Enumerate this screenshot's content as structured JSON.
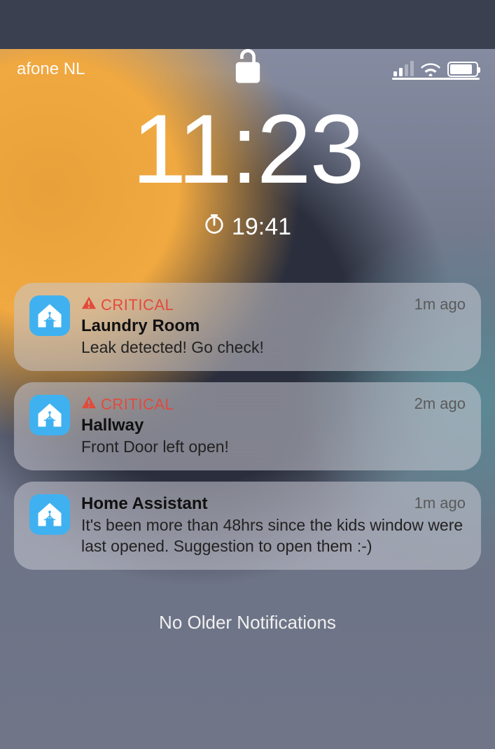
{
  "status_bar": {
    "carrier": "afone NL",
    "signal_active_bars": 2
  },
  "lock_screen": {
    "time": "11:23",
    "timer": "19:41"
  },
  "badge_label": "CRITICAL",
  "notifications": [
    {
      "critical": true,
      "title": "Laundry Room",
      "body": "Leak detected! Go check!",
      "time": "1m ago"
    },
    {
      "critical": true,
      "title": "Hallway",
      "body": "Front Door left open!",
      "time": "2m ago"
    },
    {
      "critical": false,
      "title": "Home Assistant",
      "body": "It's been more than 48hrs since the kids window were last opened. Suggestion to open them :-)",
      "time": "1m ago"
    }
  ],
  "footer": "No Older Notifications"
}
